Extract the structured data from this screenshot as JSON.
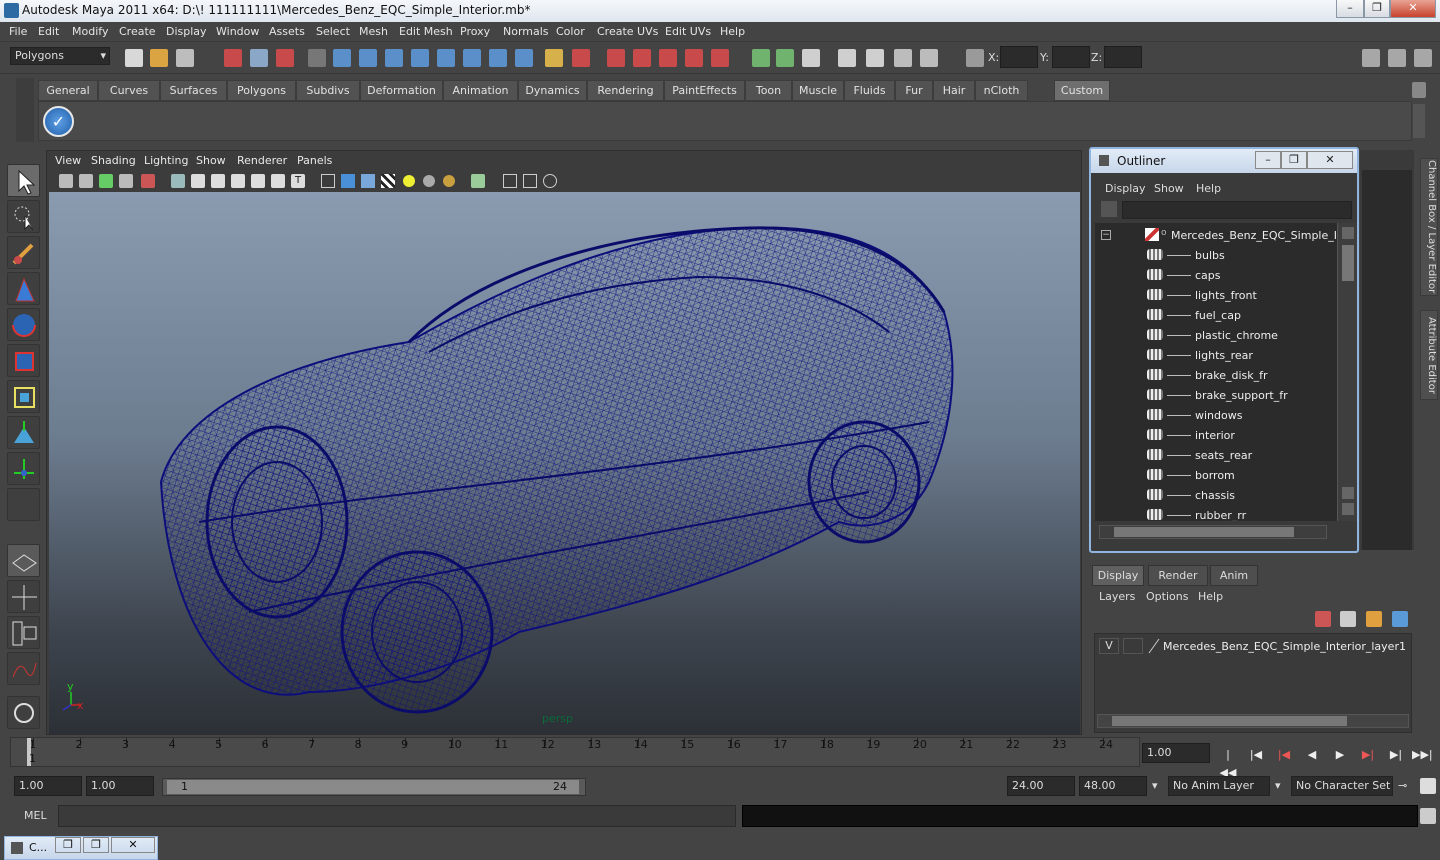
{
  "title": "Autodesk Maya 2011 x64: D:\\! 111111111\\Mercedes_Benz_EQC_Simple_Interior.mb*",
  "window_buttons": [
    "–",
    "❐",
    "✕"
  ],
  "menus": [
    "File",
    "Edit",
    "Modify",
    "Create",
    "Display",
    "Window",
    "Assets",
    "Select",
    "Mesh",
    "Edit Mesh",
    "Proxy",
    "Normals",
    "Color",
    "Create UVs",
    "Edit UVs",
    "Help"
  ],
  "status": {
    "mode": "Polygons",
    "x_label": "X:",
    "y_label": "Y:",
    "z_label": "Z:"
  },
  "shelf_tabs": [
    "General",
    "Curves",
    "Surfaces",
    "Polygons",
    "Subdivs",
    "Deformation",
    "Animation",
    "Dynamics",
    "Rendering",
    "PaintEffects",
    "Toon",
    "Muscle",
    "Fluids",
    "Fur",
    "Hair",
    "nCloth",
    "Custom"
  ],
  "shelf_active": "Custom",
  "viewport": {
    "menus": [
      "View",
      "Shading",
      "Lighting",
      "Show",
      "Renderer",
      "Panels"
    ],
    "camera_label": "persp",
    "axis_y": "y",
    "axis_x": "x"
  },
  "outliner": {
    "title": "Outliner",
    "menus": [
      "Display",
      "Show",
      "Help"
    ],
    "root": "Mercedes_Benz_EQC_Simple_Inte",
    "items": [
      "bulbs",
      "caps",
      "lights_front",
      "fuel_cap",
      "plastic_chrome",
      "lights_rear",
      "brake_disk_fr",
      "brake_support_fr",
      "windows",
      "interior",
      "seats_rear",
      "borrom",
      "chassis",
      "rubber_rr"
    ]
  },
  "right_tabs": [
    "Channel Box / Layer Editor",
    "Attribute Editor"
  ],
  "layers": {
    "tabs": [
      "Display",
      "Render",
      "Anim"
    ],
    "active_tab": "Display",
    "menus": [
      "Layers",
      "Options",
      "Help"
    ],
    "layer_visibility": "V",
    "layer_name": "Mercedes_Benz_EQC_Simple_Interior_layer1"
  },
  "timeslider": {
    "ticks": [
      "1",
      "2",
      "3",
      "4",
      "5",
      "6",
      "7",
      "8",
      "9",
      "10",
      "11",
      "12",
      "13",
      "14",
      "15",
      "16",
      "17",
      "18",
      "19",
      "20",
      "21",
      "22",
      "23",
      "24"
    ],
    "current_frame_marker": "1",
    "current_time": "1.00"
  },
  "range": {
    "start": "1.00",
    "playback_start": "1.00",
    "range_start_label": "1",
    "range_end_label": "24",
    "playback_end": "24.00",
    "end": "48.00",
    "anim_layer": "No Anim Layer",
    "character_set": "No Character Set"
  },
  "cmd": {
    "label": "MEL"
  },
  "taskbar": {
    "label": "C..."
  },
  "colors": {
    "wireframe": "#0d0e7a",
    "accent": "#8fb5e0"
  }
}
